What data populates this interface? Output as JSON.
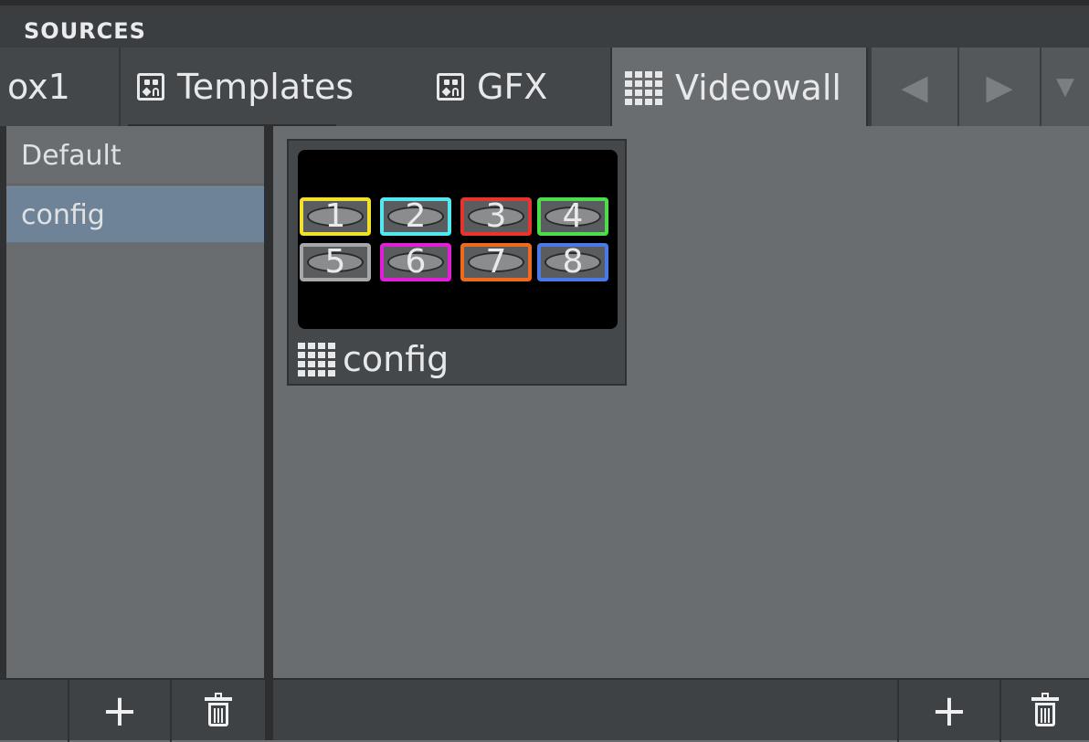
{
  "panel": {
    "title": "SOURCES"
  },
  "tabs": [
    {
      "label": "ox1",
      "icon": "none",
      "active": false
    },
    {
      "label": "Templates",
      "icon": "template-icon",
      "active": false
    },
    {
      "label": "GFX",
      "icon": "template-icon",
      "active": false
    },
    {
      "label": "Videowall",
      "icon": "videowall-grid-icon",
      "active": true
    }
  ],
  "tab_nav": {
    "left": "◀",
    "right": "▶",
    "menu": "▼"
  },
  "list": {
    "items": [
      {
        "label": "Default",
        "selected": false
      },
      {
        "label": "config",
        "selected": true
      }
    ]
  },
  "card": {
    "label": "config",
    "screens": [
      {
        "num": "1",
        "color": "#f2e02a"
      },
      {
        "num": "2",
        "color": "#52e8f0"
      },
      {
        "num": "3",
        "color": "#e8342a"
      },
      {
        "num": "4",
        "color": "#4cde4a"
      },
      {
        "num": "5",
        "color": "#a6a8aa"
      },
      {
        "num": "6",
        "color": "#e21ed8"
      },
      {
        "num": "7",
        "color": "#f06a1e"
      },
      {
        "num": "8",
        "color": "#4a7ae8"
      }
    ]
  },
  "footer": {
    "add": "+",
    "delete_icon": "trash-icon"
  },
  "colors": {
    "selected_row": "#6e8398",
    "header": "#3b3e41",
    "background": "#6a6d70"
  }
}
